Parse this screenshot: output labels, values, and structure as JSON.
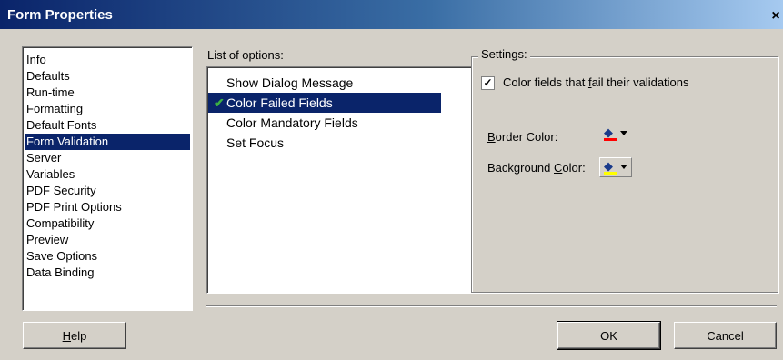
{
  "window": {
    "title": "Form Properties",
    "close_glyph": "×"
  },
  "categories": {
    "selected_index": 5,
    "items": [
      "Info",
      "Defaults",
      "Run-time",
      "Formatting",
      "Default Fonts",
      "Form Validation",
      "Server",
      "Variables",
      "PDF Security",
      "PDF Print Options",
      "Compatibility",
      "Preview",
      "Save Options",
      "Data Binding"
    ]
  },
  "options": {
    "label": "List of options:",
    "selected_index": 1,
    "checked_index": 1,
    "items": [
      "Show Dialog Message",
      "Color Failed Fields",
      "Color Mandatory Fields",
      "Set Focus"
    ]
  },
  "settings": {
    "group_title": "Settings:",
    "checkbox": {
      "checked": true,
      "label_before": "Color fields that ",
      "label_ul": "f",
      "label_after": "ail their validations"
    },
    "border_color": {
      "label_ul": "B",
      "label_rest": "order Color:",
      "color": "#ff0000",
      "icon": "paint-bucket-icon"
    },
    "background_color": {
      "label_before": "Background ",
      "label_ul": "C",
      "label_rest": "olor:",
      "color": "#ffff00",
      "icon": "paint-bucket-icon"
    }
  },
  "buttons": {
    "help_ul": "H",
    "help_rest": "elp",
    "ok": "OK",
    "cancel": "Cancel"
  }
}
